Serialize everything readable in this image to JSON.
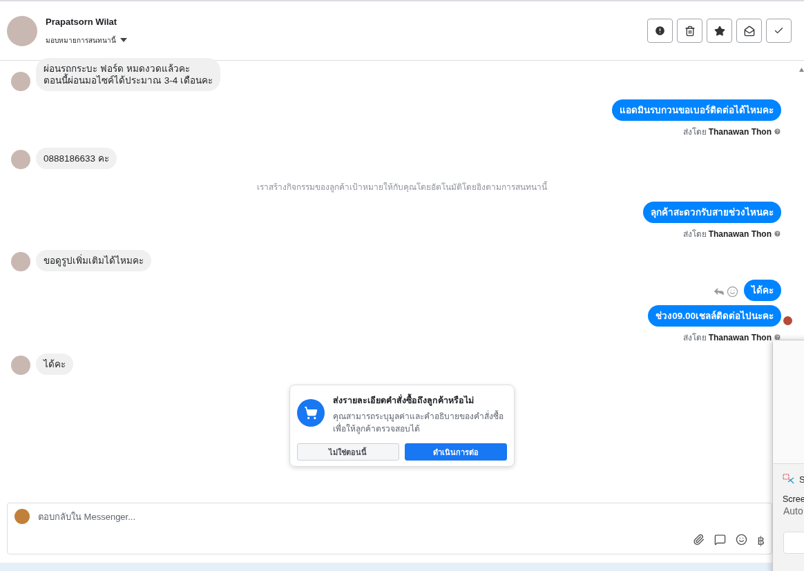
{
  "header": {
    "name": "Prapatsorn Wilat",
    "assign_label": "มอบหมายการสนทนานี้",
    "actions": [
      {
        "kind": "alert"
      },
      {
        "kind": "trash"
      },
      {
        "kind": "star"
      },
      {
        "kind": "mail"
      },
      {
        "kind": "check"
      }
    ]
  },
  "messages": [
    {
      "kind": "in",
      "lines": [
        "ผ่อนรถกระบะ ฟอร์ด หมดงวดแล้วคะ",
        "ตอนนี้ผ่อนมอไซค์ได้ประมาณ 3-4 เดือนคะ"
      ]
    },
    {
      "kind": "out",
      "lines": [
        "แอดมินรบกวนขอเบอร์ติดต่อได้ไหมคะ"
      ],
      "sender_label": "ส่งโดย",
      "sender": "Thanawan Thon",
      "actions": false,
      "seen": false
    },
    {
      "kind": "in",
      "lines": [
        "0888186633 คะ"
      ]
    },
    {
      "kind": "system",
      "lines": [
        "เราสร้างกิจกรรมของลูกค้าเป้าหมายให้กับคุณโดยอัตโนมัติโดยอิงตามการสนทนานี้"
      ]
    },
    {
      "kind": "out",
      "lines": [
        "ลุกค้าสะดวกรับสายช่วงไหนคะ"
      ],
      "sender_label": "ส่งโดย",
      "sender": "Thanawan Thon",
      "actions": false,
      "seen": false
    },
    {
      "kind": "in",
      "lines": [
        "ขอดูรูปเพิ่มเติมได้ไหมคะ"
      ]
    },
    {
      "kind": "out",
      "lines": [
        "ได้คะ"
      ],
      "actions": true,
      "seen": false
    },
    {
      "kind": "out",
      "lines": [
        "ช่วง09.00เชลล์ติดต่อไปนะคะ"
      ],
      "sender_label": "ส่งโดย",
      "sender": "Thanawan Thon",
      "actions": false,
      "seen": true
    },
    {
      "kind": "in",
      "lines": [
        "ได้คะ"
      ]
    }
  ],
  "order_prompt": {
    "title": "ส่งรายละเอียดคำสั่งซื้อถึงลูกค้าหรือไม่",
    "body": "คุณสามารถระบุมูลค่าและคำอธิบายของคำสั่งซื้อเพื่อให้ลูกค้าตรวจสอบได้",
    "buttons": [
      {
        "label": "ไม่ใช่ตอนนี้",
        "primary": false
      },
      {
        "label": "ดำเนินการต่อ",
        "primary": true
      }
    ]
  },
  "composer": {
    "placeholder": "ตอบกลับใน Messenger...",
    "tools": [
      {
        "kind": "attach"
      },
      {
        "kind": "chat"
      },
      {
        "kind": "emoji"
      },
      {
        "kind": "text",
        "label": "฿"
      }
    ]
  },
  "snip_notification": {
    "app_initial": "S",
    "title": "Scree",
    "subtitle": "Auto"
  }
}
